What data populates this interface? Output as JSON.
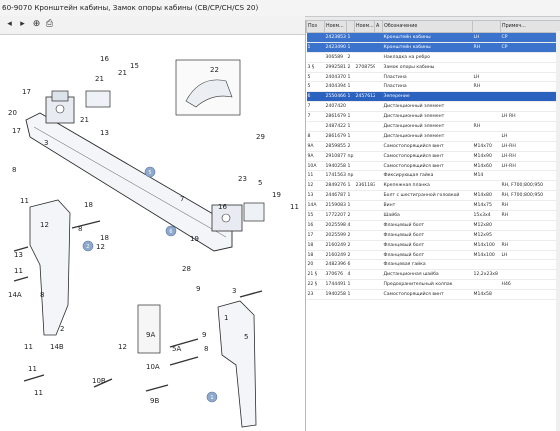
{
  "title": "60-9070 Кронштейн кабины, Замок опоры кабины (CB/CP/CH/CS 20)",
  "diagram": {
    "callouts": [
      "16",
      "21",
      "15",
      "21",
      "20",
      "22",
      "17",
      "17",
      "3",
      "13",
      "8",
      "21",
      "29",
      "7",
      "11",
      "23",
      "19",
      "5",
      "18",
      "11",
      "12",
      "8",
      "18",
      "12",
      "11",
      "13",
      "14A",
      "16",
      "19",
      "28",
      "9",
      "8",
      "2",
      "3",
      "1",
      "5",
      "11",
      "14B",
      "11",
      "12",
      "9A",
      "5A",
      "10A",
      "9",
      "10B",
      "9B",
      "11",
      "8"
    ],
    "bubbles": [
      "5",
      "2",
      "6",
      "1"
    ]
  },
  "table": {
    "headers": [
      "Поз",
      "Ноем...",
      "",
      "Ноем...",
      "A",
      "Обозначение",
      "",
      "Примеч..."
    ],
    "rows": [
      {
        "pos": "",
        "num": "2423853",
        "qty": "1",
        "alt": "",
        "name": "Кронштейн кабины",
        "code": "LH",
        "note": "CP"
      },
      {
        "pos": "1",
        "num": "2423490",
        "qty": "1",
        "alt": "",
        "name": "Кронштейн кабины",
        "code": "RH",
        "note": "CP"
      },
      {
        "pos": "",
        "num": "306589",
        "qty": "2",
        "alt": "",
        "name": "Накладка на ребро",
        "code": "",
        "note": ""
      },
      {
        "pos": "3 §",
        "num": "2992581",
        "qty": "2",
        "alt": "2708759",
        "name": "Замок опоры кабины",
        "code": "",
        "note": ""
      },
      {
        "pos": "5",
        "num": "2404370",
        "qty": "1",
        "alt": "",
        "name": "Пластина",
        "code": "LH",
        "note": ""
      },
      {
        "pos": "5",
        "num": "2404394",
        "qty": "1",
        "alt": "",
        "name": "Пластина",
        "code": "RH",
        "note": ""
      },
      {
        "pos": "6",
        "num": "2550466",
        "qty": "1",
        "alt": "2457612",
        "name": "Зеперение",
        "code": "",
        "note": ""
      },
      {
        "pos": "7",
        "num": "2407420",
        "qty": "",
        "alt": "",
        "name": "Дистанционный элемент",
        "code": "",
        "note": ""
      },
      {
        "pos": "7",
        "num": "2861679",
        "qty": "1",
        "alt": "",
        "name": "Дистанционный элемент",
        "code": "",
        "note": "LH RH"
      },
      {
        "pos": "",
        "num": "2487422",
        "qty": "1",
        "alt": "",
        "name": "Дистанционный элемент",
        "code": "RH",
        "note": ""
      },
      {
        "pos": "8",
        "num": "2861679",
        "qty": "1",
        "alt": "",
        "name": "Дистанционный элемент",
        "code": "",
        "note": "LH"
      },
      {
        "pos": "9A",
        "num": "2859855",
        "qty": "2",
        "alt": "",
        "name": "Самостопорящийся винт",
        "code": "M14x70",
        "note": "LH-RH"
      },
      {
        "pos": "9A",
        "num": "2910877",
        "qty": "пр",
        "alt": "",
        "name": "Самостопорящийся винт",
        "code": "M14x90",
        "note": "LH-RH"
      },
      {
        "pos": "10A",
        "num": "1940258",
        "qty": "1",
        "alt": "",
        "name": "Самостопорящийся винт",
        "code": "M14x60",
        "note": "LH-RH"
      },
      {
        "pos": "11",
        "num": "1741563",
        "qty": "пр",
        "alt": "",
        "name": "Фиксирующая гайка",
        "code": "M14",
        "note": ""
      },
      {
        "pos": "12",
        "num": "2849276",
        "qty": "1",
        "alt": "2361183",
        "name": "Крепежная планка",
        "code": "",
        "note": "RH, F700;800;950"
      },
      {
        "pos": "13",
        "num": "2446787",
        "qty": "1",
        "alt": "",
        "name": "Болт с шестигранной головкой",
        "code": "M14x80",
        "note": "RH, F700;800;950"
      },
      {
        "pos": "14A",
        "num": "2159083",
        "qty": "1",
        "alt": "",
        "name": "Винт",
        "code": "M14x75",
        "note": "RH"
      },
      {
        "pos": "15",
        "num": "1772207",
        "qty": "2",
        "alt": "",
        "name": "Шайба",
        "code": "15x3x4",
        "note": "RH"
      },
      {
        "pos": "16",
        "num": "2025598",
        "qty": "4",
        "alt": "",
        "name": "Фланцевый болт",
        "code": "M12x80",
        "note": ""
      },
      {
        "pos": "17",
        "num": "2025599",
        "qty": "2",
        "alt": "",
        "name": "Фланцевый болт",
        "code": "M12x95",
        "note": ""
      },
      {
        "pos": "18",
        "num": "2160249",
        "qty": "2",
        "alt": "",
        "name": "Фланцевый болт",
        "code": "M14x100",
        "note": "RH"
      },
      {
        "pos": "18",
        "num": "2160249",
        "qty": "2",
        "alt": "",
        "name": "Фланцевый болт",
        "code": "M14x100",
        "note": "LH"
      },
      {
        "pos": "20",
        "num": "2482396",
        "qty": "6",
        "alt": "",
        "name": "Фланцевая гайка",
        "code": "",
        "note": ""
      },
      {
        "pos": "21 §",
        "num": "370676",
        "qty": "4",
        "alt": "",
        "name": "Дистанционная шайба",
        "code": "12,2x23x8",
        "note": ""
      },
      {
        "pos": "22 §",
        "num": "1744491",
        "qty": "1",
        "alt": "",
        "name": "Предохранительный колпак",
        "code": "",
        "note": "H46"
      },
      {
        "pos": "23",
        "num": "1940258",
        "qty": "1",
        "alt": "",
        "name": "Самостопорящийся винт",
        "code": "M14x58",
        "note": ""
      }
    ]
  }
}
